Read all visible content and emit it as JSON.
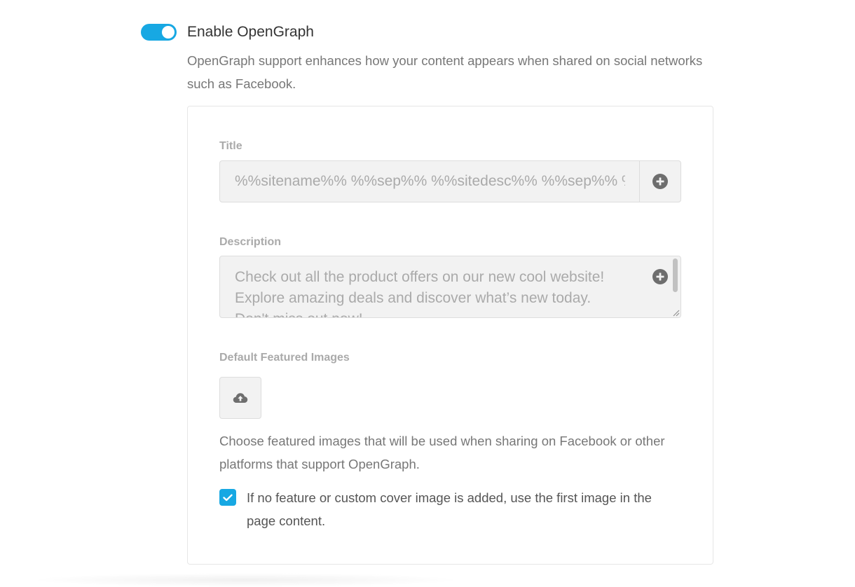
{
  "opengraph": {
    "toggle_enabled": true,
    "title": "Enable OpenGraph",
    "description": "OpenGraph support enhances how your content appears when shared on social networks such as Facebook.",
    "accent_color": "#17a8e3"
  },
  "form": {
    "title_label": "Title",
    "title_value": "%%sitename%% %%sep%% %%sitedesc%% %%sep%% %%page%%",
    "title_insert_icon": "plus-circle-icon",
    "description_label": "Description",
    "description_value": "Check out all the product offers on our new cool website! Explore amazing deals and discover what’s new today. Don't miss out now!",
    "description_insert_icon": "plus-circle-icon",
    "images_label": "Default Featured Images",
    "upload_icon": "cloud-upload-icon",
    "images_help": "Choose featured images that will be used when sharing on Facebook or other platforms that support OpenGraph.",
    "first_image_checked": true,
    "first_image_label": "If no feature or custom cover image is added, use the first image in the page content."
  }
}
